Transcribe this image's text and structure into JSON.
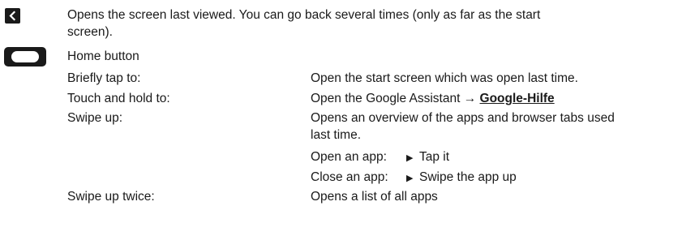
{
  "back": {
    "icon": "chevron-left-icon",
    "line1": "Opens the screen last viewed. You can go back several times (only as far as the start",
    "line2": "screen)."
  },
  "home": {
    "icon": "home-button-icon",
    "title": "Home button",
    "briefly_label": "Briefly tap to:",
    "briefly_desc": "Open the start screen which was open last time.",
    "hold_label": "Touch and hold to:",
    "hold_desc": "Open the Google Assistant",
    "hold_arrow": "→",
    "hold_link": "Google-Hilfe",
    "swipe_label": "Swipe up:",
    "swipe_desc1": "Opens an overview of the apps and browser tabs used",
    "swipe_desc2": "last time.",
    "open_label": "Open an app:",
    "open_action": "Tap it",
    "close_label": "Close an app:",
    "close_action": "Swipe the app up",
    "twice_label": "Swipe up twice:",
    "twice_desc": "Opens a list of all apps"
  }
}
